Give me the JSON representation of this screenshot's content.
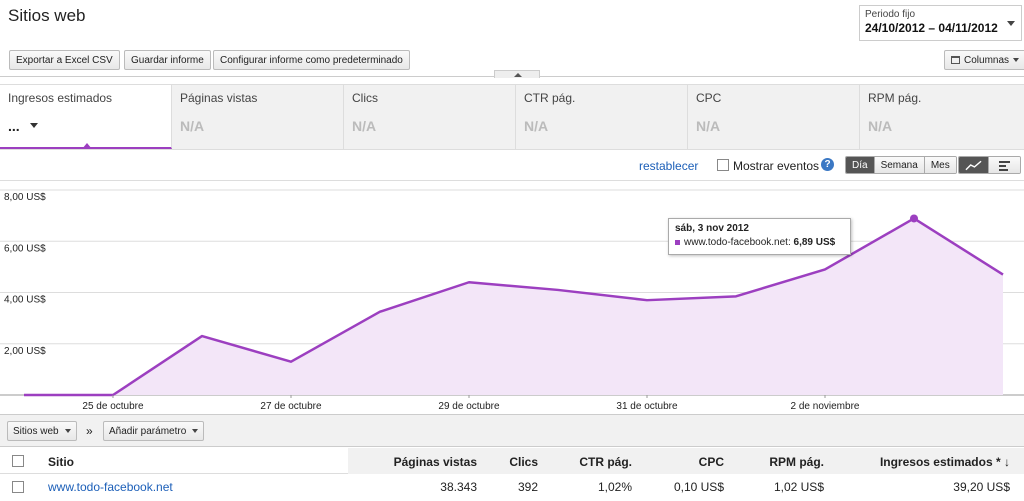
{
  "header": {
    "title": "Sitios web"
  },
  "period": {
    "label": "Periodo fijo",
    "range": "24/10/2012 – 04/11/2012"
  },
  "toolbar": {
    "export": "Exportar a Excel CSV",
    "save": "Guardar informe",
    "config": "Configurar informe como predeterminado",
    "columns": "Columnas"
  },
  "metrics": [
    {
      "name": "Ingresos estimados",
      "value": "..."
    },
    {
      "name": "Páginas vistas",
      "value": "N/A"
    },
    {
      "name": "Clics",
      "value": "N/A"
    },
    {
      "name": "CTR pág.",
      "value": "N/A"
    },
    {
      "name": "CPC",
      "value": "N/A"
    },
    {
      "name": "RPM pág.",
      "value": "N/A"
    }
  ],
  "chart_controls": {
    "reset": "restablecer",
    "show_events": "Mostrar eventos",
    "help": "?",
    "granularity": [
      "Día",
      "Semana",
      "Mes"
    ],
    "selected": "Día"
  },
  "chart_data": {
    "type": "area",
    "x": [
      "24 oct",
      "25 oct",
      "26 oct",
      "27 oct",
      "28 oct",
      "29 oct",
      "30 oct",
      "31 oct",
      "1 nov",
      "2 nov",
      "3 nov",
      "4 nov"
    ],
    "series": [
      {
        "name": "www.todo-facebook.net",
        "values": [
          0.0,
          0.0,
          2.3,
          1.3,
          3.25,
          4.4,
          4.1,
          3.7,
          3.85,
          4.9,
          6.89,
          4.7
        ]
      }
    ],
    "ylim": [
      0,
      8
    ],
    "yticks": [
      "2,00 US$",
      "4,00 US$",
      "6,00 US$",
      "8,00 US$"
    ],
    "xtick_labels": [
      "25 de octubre",
      "27 de octubre",
      "29 de octubre",
      "31 de octubre",
      "2 de noviembre"
    ],
    "color": "#9c3fc0",
    "grid": true,
    "tooltip": {
      "date": "sáb, 3 nov 2012",
      "series": "www.todo-facebook.net:",
      "value": "6,89 US$"
    }
  },
  "filters": {
    "dimension": "Sitios web",
    "arrows": "»",
    "add": "Añadir parámetro"
  },
  "table": {
    "headers": [
      "Sitio",
      "Páginas vistas",
      "Clics",
      "CTR pág.",
      "CPC",
      "RPM pág.",
      "Ingresos estimados *"
    ],
    "sort_marker": "↓",
    "rows": [
      [
        "www.todo-facebook.net",
        "38.343",
        "392",
        "1,02%",
        "0,10 US$",
        "1,02 US$",
        "39,20 US$"
      ]
    ]
  }
}
